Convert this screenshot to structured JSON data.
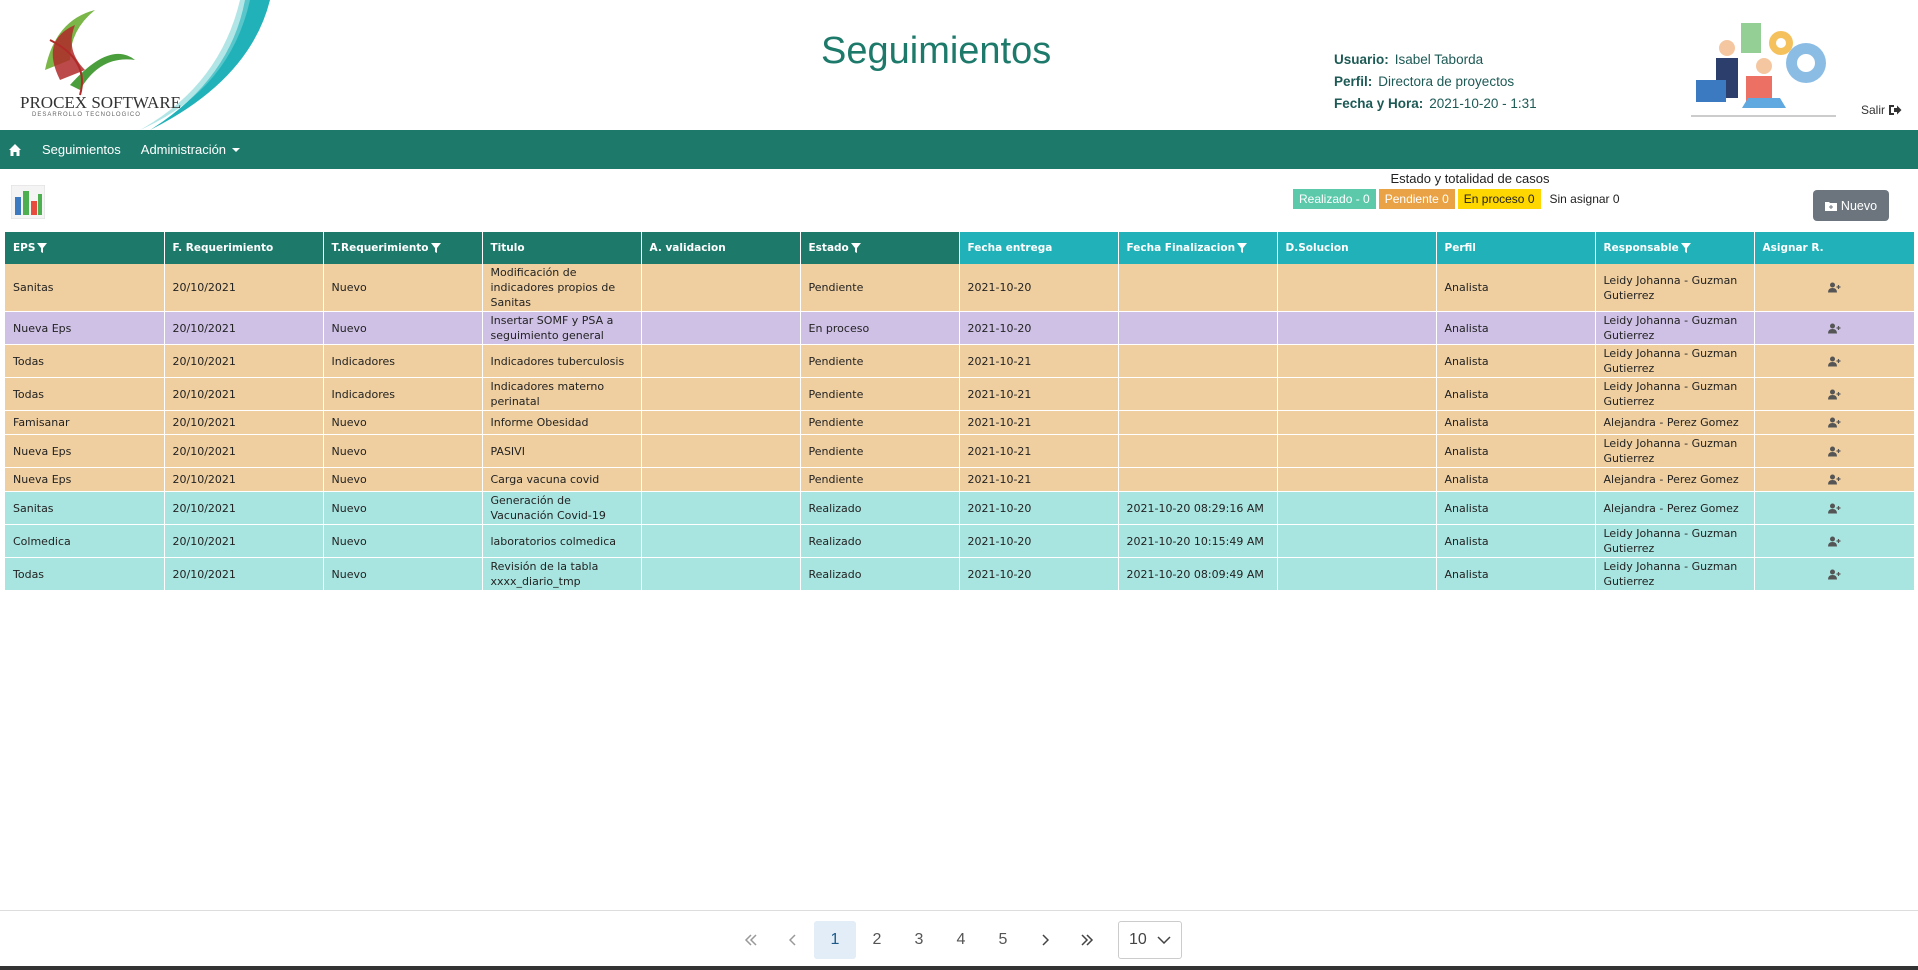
{
  "header": {
    "logo_text": "PROCEX SOFTWARE",
    "logo_subtext": "DESARROLLO TECNOLOGICO",
    "title": "Seguimientos",
    "user_label": "Usuario:",
    "user_value": "Isabel Taborda",
    "perfil_label": "Perfil:",
    "perfil_value": "Directora de proyectos",
    "fecha_label": "Fecha y Hora:",
    "fecha_value": "2021-10-20 - 1:31",
    "salir_label": "Salir"
  },
  "navbar": {
    "home_icon": "home-icon",
    "items": [
      {
        "label": "Seguimientos"
      },
      {
        "label": "Administración"
      }
    ]
  },
  "status_summary": {
    "title": "Estado y totalidad de casos",
    "realizado": "Realizado - 0",
    "pendiente": "Pendiente 0",
    "en_proceso": "En proceso 0",
    "sin_asignar": "Sin asignar 0",
    "colors": {
      "realizado": "#5cc9aa",
      "pendiente": "#eaa247",
      "en_proceso": "#ffd700"
    }
  },
  "toolbar": {
    "nuevo_label": "Nuevo"
  },
  "table": {
    "headers": [
      {
        "label": "EPS",
        "filter": true
      },
      {
        "label": "F. Requerimiento",
        "filter": false
      },
      {
        "label": "T.Requerimiento",
        "filter": true
      },
      {
        "label": "Titulo",
        "filter": false
      },
      {
        "label": "A. validacion",
        "filter": false
      },
      {
        "label": "Estado",
        "filter": true
      },
      {
        "label": "Fecha entrega",
        "filter": false
      },
      {
        "label": "Fecha Finalizacion",
        "filter": true
      },
      {
        "label": "D.Solucion",
        "filter": false
      },
      {
        "label": "Perfil",
        "filter": false
      },
      {
        "label": "Responsable",
        "filter": true
      },
      {
        "label": "Asignar R.",
        "filter": false
      }
    ],
    "rows": [
      {
        "eps": "Sanitas",
        "f_req": "20/10/2021",
        "t_req": "Nuevo",
        "titulo": "Modificación de indicadores propios de Sanitas",
        "a_val": "",
        "estado": "Pendiente",
        "f_entrega": "2021-10-20",
        "f_final": "",
        "d_sol": "",
        "perfil": "Analista",
        "responsable": "Leidy Johanna - Guzman Gutierrez"
      },
      {
        "eps": "Nueva Eps",
        "f_req": "20/10/2021",
        "t_req": "Nuevo",
        "titulo": "Insertar SOMF y PSA a seguimiento general",
        "a_val": "",
        "estado": "En proceso",
        "f_entrega": "2021-10-20",
        "f_final": "",
        "d_sol": "",
        "perfil": "Analista",
        "responsable": "Leidy Johanna - Guzman Gutierrez"
      },
      {
        "eps": "Todas",
        "f_req": "20/10/2021",
        "t_req": "Indicadores",
        "titulo": "Indicadores tuberculosis",
        "a_val": "",
        "estado": "Pendiente",
        "f_entrega": "2021-10-21",
        "f_final": "",
        "d_sol": "",
        "perfil": "Analista",
        "responsable": "Leidy Johanna - Guzman Gutierrez"
      },
      {
        "eps": "Todas",
        "f_req": "20/10/2021",
        "t_req": "Indicadores",
        "titulo": "Indicadores materno perinatal",
        "a_val": "",
        "estado": "Pendiente",
        "f_entrega": "2021-10-21",
        "f_final": "",
        "d_sol": "",
        "perfil": "Analista",
        "responsable": "Leidy Johanna - Guzman Gutierrez"
      },
      {
        "eps": "Famisanar",
        "f_req": "20/10/2021",
        "t_req": "Nuevo",
        "titulo": "Informe Obesidad",
        "a_val": "",
        "estado": "Pendiente",
        "f_entrega": "2021-10-21",
        "f_final": "",
        "d_sol": "",
        "perfil": "Analista",
        "responsable": "Alejandra - Perez Gomez"
      },
      {
        "eps": "Nueva Eps",
        "f_req": "20/10/2021",
        "t_req": "Nuevo",
        "titulo": "PASIVI",
        "a_val": "",
        "estado": "Pendiente",
        "f_entrega": "2021-10-21",
        "f_final": "",
        "d_sol": "",
        "perfil": "Analista",
        "responsable": "Leidy Johanna - Guzman Gutierrez"
      },
      {
        "eps": "Nueva Eps",
        "f_req": "20/10/2021",
        "t_req": "Nuevo",
        "titulo": "Carga vacuna covid",
        "a_val": "",
        "estado": "Pendiente",
        "f_entrega": "2021-10-21",
        "f_final": "",
        "d_sol": "",
        "perfil": "Analista",
        "responsable": "Alejandra - Perez Gomez"
      },
      {
        "eps": "Sanitas",
        "f_req": "20/10/2021",
        "t_req": "Nuevo",
        "titulo": "Generación de Vacunación Covid-19",
        "a_val": "",
        "estado": "Realizado",
        "f_entrega": "2021-10-20",
        "f_final": "2021-10-20 08:29:16 AM",
        "d_sol": "",
        "perfil": "Analista",
        "responsable": "Alejandra - Perez Gomez"
      },
      {
        "eps": "Colmedica",
        "f_req": "20/10/2021",
        "t_req": "Nuevo",
        "titulo": "laboratorios colmedica",
        "a_val": "",
        "estado": "Realizado",
        "f_entrega": "2021-10-20",
        "f_final": "2021-10-20 10:15:49 AM",
        "d_sol": "",
        "perfil": "Analista",
        "responsable": "Leidy Johanna - Guzman Gutierrez"
      },
      {
        "eps": "Todas",
        "f_req": "20/10/2021",
        "t_req": "Nuevo",
        "titulo": "Revisión de la tabla xxxx_diario_tmp",
        "a_val": "",
        "estado": "Realizado",
        "f_entrega": "2021-10-20",
        "f_final": "2021-10-20 08:09:49 AM",
        "d_sol": "",
        "perfil": "Analista",
        "responsable": "Leidy Johanna - Guzman Gutierrez"
      }
    ],
    "row_colors": {
      "Pendiente": "#efcfa0",
      "En proceso": "#cfc1e6",
      "Realizado": "#a9e5e0"
    }
  },
  "pagination": {
    "pages": [
      "1",
      "2",
      "3",
      "4",
      "5"
    ],
    "active_page": "1",
    "page_size": "10"
  }
}
